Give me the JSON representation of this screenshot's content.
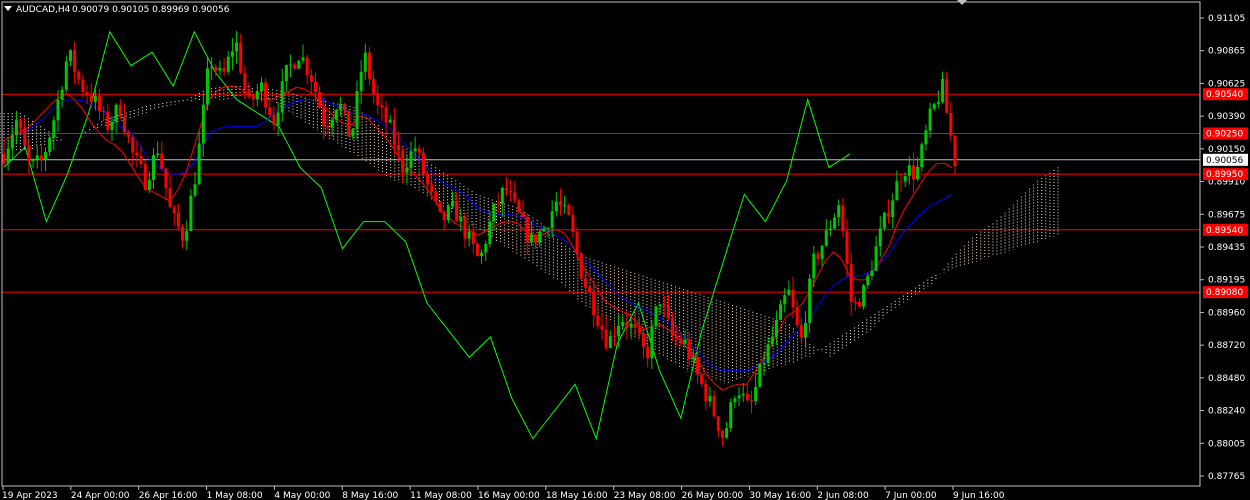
{
  "window": {
    "symbol_title": "AUDCAD,H4",
    "ohlc": "0.90079 0.90105 0.89969 0.90056"
  },
  "colors": {
    "background": "#000000",
    "bull_candle": "#00c800",
    "bear_candle": "#ff0000",
    "tenkan": "#ff0000",
    "kijun": "#0000ff",
    "chikou": "#00ff00",
    "kumo_a": "#ffe4c4",
    "kumo_b": "#ffffff",
    "level_line": "#ff0000",
    "price_line": "#c0c0c0",
    "axis_text": "#ffffff"
  },
  "chart_data": {
    "type": "candlestick",
    "symbol": "AUDCAD",
    "timeframe": "H4",
    "ylim": [
      0.8765,
      0.9122
    ],
    "price_ticks": [
      "0.91105",
      "0.90865",
      "0.90625",
      "0.90390",
      "0.90150",
      "0.89910",
      "0.89675",
      "0.89435",
      "0.89195",
      "0.88960",
      "0.88720",
      "0.88480",
      "0.88240",
      "0.88005",
      "0.87765"
    ],
    "time_labels": [
      "19 Apr 2023",
      "24 Apr 00:00",
      "26 Apr 16:00",
      "1 May 08:00",
      "4 May 00:00",
      "8 May 16:00",
      "11 May 08:00",
      "16 May 00:00",
      "18 May 16:00",
      "23 May 08:00",
      "26 May 00:00",
      "30 May 16:00",
      "2 Jun 08:00",
      "7 Jun 00:00",
      "9 Jun 16:00"
    ],
    "levels": [
      {
        "label": "0.90540",
        "value": 0.9054
      },
      {
        "label": "0.90250",
        "value": 0.9025
      },
      {
        "label": "0.89950",
        "value": 0.8995
      },
      {
        "label": "0.89540",
        "value": 0.8954
      },
      {
        "label": "0.89080",
        "value": 0.8908
      }
    ],
    "current_price": {
      "label": "0.90056",
      "value": 0.90056
    },
    "close_path": [
      0.901,
      0.9035,
      0.9,
      0.9005,
      0.904,
      0.9085,
      0.906,
      0.905,
      0.903,
      0.9045,
      0.901,
      0.899,
      0.9015,
      0.8965,
      0.8948,
      0.9,
      0.908,
      0.9065,
      0.9095,
      0.9045,
      0.906,
      0.9035,
      0.907,
      0.9085,
      0.9065,
      0.903,
      0.905,
      0.902,
      0.9085,
      0.9045,
      0.903,
      0.9,
      0.9015,
      0.8985,
      0.896,
      0.897,
      0.895,
      0.893,
      0.8965,
      0.8985,
      0.8965,
      0.8945,
      0.8955,
      0.8975,
      0.896,
      0.892,
      0.8895,
      0.887,
      0.889,
      0.888,
      0.886,
      0.8905,
      0.8875,
      0.887,
      0.8845,
      0.8825,
      0.88,
      0.884,
      0.882,
      0.8855,
      0.888,
      0.891,
      0.887,
      0.893,
      0.895,
      0.8975,
      0.8895,
      0.891,
      0.8945,
      0.8975,
      0.9,
      0.8995,
      0.9035,
      0.906,
      0.9005
    ],
    "tenkan_path": [
      0.902,
      0.9025,
      0.903,
      0.904,
      0.905,
      0.9055,
      0.9045,
      0.903,
      0.902,
      0.9015,
      0.9,
      0.8985,
      0.898,
      0.8975,
      0.899,
      0.902,
      0.905,
      0.906,
      0.906,
      0.9055,
      0.905,
      0.905,
      0.9055,
      0.906,
      0.9055,
      0.9045,
      0.9035,
      0.903,
      0.904,
      0.903,
      0.902,
      0.9005,
      0.8995,
      0.8985,
      0.897,
      0.896,
      0.8955,
      0.895,
      0.8955,
      0.896,
      0.896,
      0.895,
      0.895,
      0.8955,
      0.895,
      0.893,
      0.8915,
      0.89,
      0.8895,
      0.889,
      0.888,
      0.8885,
      0.888,
      0.887,
      0.886,
      0.8845,
      0.8835,
      0.884,
      0.884,
      0.8855,
      0.887,
      0.889,
      0.8895,
      0.891,
      0.893,
      0.894,
      0.892,
      0.8915,
      0.8925,
      0.894,
      0.8965,
      0.898,
      0.8995,
      0.9005,
      0.9
    ],
    "kijun_path": [
      0.9025,
      0.9025,
      0.9028,
      0.9035,
      0.9045,
      0.905,
      0.905,
      0.9045,
      0.904,
      0.903,
      0.9025,
      0.901,
      0.9,
      0.8995,
      0.8995,
      0.9005,
      0.9025,
      0.903,
      0.903,
      0.903,
      0.903,
      0.904,
      0.9045,
      0.905,
      0.905,
      0.905,
      0.9045,
      0.904,
      0.904,
      0.9035,
      0.903,
      0.902,
      0.901,
      0.9,
      0.899,
      0.8985,
      0.898,
      0.897,
      0.8965,
      0.8965,
      0.8965,
      0.896,
      0.8955,
      0.895,
      0.8945,
      0.8935,
      0.8925,
      0.8915,
      0.8905,
      0.89,
      0.8895,
      0.889,
      0.8885,
      0.8875,
      0.8865,
      0.8855,
      0.885,
      0.885,
      0.885,
      0.8855,
      0.886,
      0.887,
      0.888,
      0.889,
      0.8905,
      0.8915,
      0.892,
      0.892,
      0.8925,
      0.8935,
      0.895,
      0.896,
      0.897,
      0.8975,
      0.898
    ],
    "chikou_path": [
      0.9,
      0.9015,
      0.896,
      0.8995,
      0.904,
      0.91,
      0.9075,
      0.9085,
      0.906,
      0.91,
      0.907,
      0.905,
      0.904,
      0.903,
      0.9,
      0.8985,
      0.894,
      0.896,
      0.896,
      0.8945,
      0.89,
      0.888,
      0.886,
      0.8875,
      0.883,
      0.88,
      0.882,
      0.884,
      0.88,
      0.887,
      0.89,
      0.885,
      0.8815,
      0.888,
      0.893,
      0.898,
      0.896,
      0.899,
      0.905,
      0.9,
      0.901
    ],
    "kumo_a_path": [
      0.901,
      0.9012,
      0.9015,
      0.902,
      0.9025,
      0.903,
      0.9035,
      0.904,
      0.9045,
      0.9048,
      0.905,
      0.905,
      0.9055,
      0.9058,
      0.9055,
      0.905,
      0.9048,
      0.9045,
      0.9035,
      0.902,
      0.901,
      0.9,
      0.899,
      0.898,
      0.8975,
      0.897,
      0.896,
      0.8945,
      0.8935,
      0.893,
      0.8925,
      0.892,
      0.8915,
      0.891,
      0.8905,
      0.89,
      0.8895,
      0.889,
      0.8885,
      0.887,
      0.886,
      0.887,
      0.888,
      0.8895,
      0.8905,
      0.8915,
      0.8935,
      0.895,
      0.896,
      0.8975,
      0.899,
      0.9
    ],
    "kumo_b_path": [
      0.904,
      0.904,
      0.903,
      0.902,
      0.9025,
      0.9035,
      0.904,
      0.9045,
      0.9048,
      0.905,
      0.9058,
      0.906,
      0.906,
      0.905,
      0.904,
      0.903,
      0.902,
      0.901,
      0.9,
      0.899,
      0.8985,
      0.8975,
      0.8965,
      0.8955,
      0.8945,
      0.8935,
      0.8925,
      0.8915,
      0.89,
      0.889,
      0.888,
      0.887,
      0.886,
      0.885,
      0.8845,
      0.884,
      0.8845,
      0.885,
      0.8855,
      0.886,
      0.887,
      0.888,
      0.889,
      0.89,
      0.891,
      0.892,
      0.8925,
      0.893,
      0.8935,
      0.894,
      0.8945,
      0.895
    ]
  }
}
